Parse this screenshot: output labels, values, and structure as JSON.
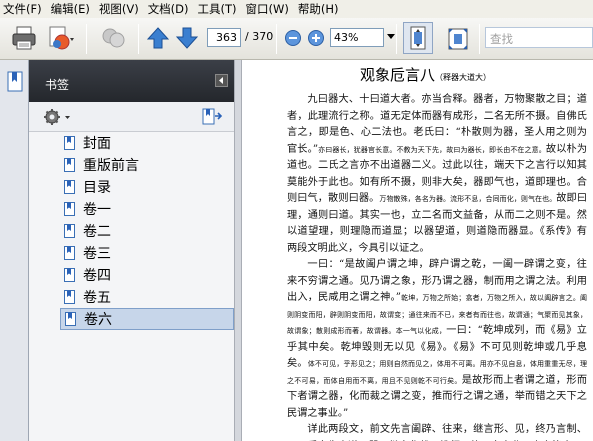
{
  "menu": [
    "文件(F)",
    "编辑(E)",
    "视图(V)",
    "文档(D)",
    "工具(T)",
    "窗口(W)",
    "帮助(H)"
  ],
  "toolbar": {
    "current_page": "363",
    "total_pages": "/ 370",
    "zoom": "43%",
    "search_placeholder": "查找"
  },
  "panel": {
    "title": "书签",
    "bookmarks": [
      "封面",
      "重版前言",
      "目录",
      "卷一",
      "卷二",
      "卷三",
      "卷四",
      "卷五",
      "卷六"
    ],
    "selected_index": 8
  },
  "document": {
    "title": "观象卮言八",
    "subtitle": "（释器大道大）",
    "paragraphs": [
      "九曰器大、十曰道大者。亦当合释。器者，万物聚散之目；道者，此理流行之称。道无定体而器有成形，二名无所不摄。自佛氏言之，即是色、心二法也。老氏曰：“朴散则为器，圣人用之则为官长。”",
      "亦曰器长，犹器官长意。不教为天下先，故曰为器长，即长由不在之意。",
      "故以朴为道也。二氏之言亦不出道器二义。过此以往，端天下之言行以知其莫能外于此也。如有所不摄，则非大矣，器即气也，道即理也。合则曰气，散则曰器。",
      "万物散殊，各名为器。流形不息，合同而化，则气在也。",
      "故即曰理，通则曰道。其实一也，立二名而文益备，从而二之则不是。然以道望理，则理隐而道显；以器望道，则道隐而器显。《系传》有两段文明此义，今具引以证之。",
      "一曰：“是故阖户谓之坤，辟户谓之乾，一阖一辟谓之变，往来不穷谓之通。见乃谓之象，形乃谓之器，制而用之谓之法。利用出入，民咸用之谓之神。”",
      "乾坤，万物之所始；翕者，万物之所入，故以阖辟言之。阖则阴变而阳，辟则阴变而阳，故谓变；通往来而不已，来者有而往也，故谓通；气聚而见其象，故谓象；散则成形而著，故谓器。本一气以化成，",
      "一曰：“乾坤成列，而《易》立乎其中矣。乾坤毁则无以见《易》。《易》不可见则乾坤或几乎息矣。",
      "体不可见，乎形见之；用则自然而见之，体用不可离。用亦不见自息，体用重重无尽，理之不可易，而体自用而不离，用且不见则乾不可行矣。",
      "是故形而上者谓之道，形而下者谓之器，化而裁之谓之变，推而行之谓之通，举而错之天下之民谓之事业。”",
      "详此两段文，前文先言阖辟、往来，继言形、见，终乃言制、用。后文先出道、器，继言化裁、推行，终乃言事业。本之皆由"
    ]
  },
  "colors": {
    "panel_header": "#2e3137",
    "selected_bg": "#c7d6ea",
    "menu_bg": "#f0efe8"
  }
}
